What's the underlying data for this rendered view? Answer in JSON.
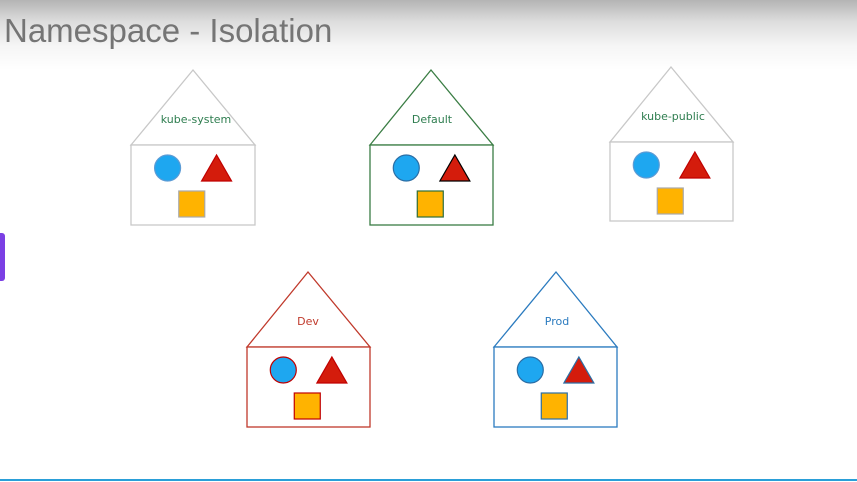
{
  "slide": {
    "title": "Namespace - Isolation"
  },
  "namespaces": [
    {
      "label": "kube-system",
      "outline_color": "#c8c8c8",
      "text_color": "#2e7d4f",
      "circle_stroke": "#5b9bd5",
      "triangle_stroke": "#c00000",
      "square_stroke": "#a9a9a9"
    },
    {
      "label": "Default",
      "outline_color": "#3a7d44",
      "text_color": "#2e7d4f",
      "circle_stroke": "#2b6ea5",
      "triangle_stroke": "#000000",
      "square_stroke": "#2e6e3a"
    },
    {
      "label": "kube-public",
      "outline_color": "#c8c8c8",
      "text_color": "#2e7d4f",
      "circle_stroke": "#5b9bd5",
      "triangle_stroke": "#c00000",
      "square_stroke": "#a9a9a9"
    },
    {
      "label": "Dev",
      "outline_color": "#c0392b",
      "text_color": "#c0392b",
      "circle_stroke": "#c00000",
      "triangle_stroke": "#c00000",
      "square_stroke": "#c00000"
    },
    {
      "label": "Prod",
      "outline_color": "#2b7bbf",
      "text_color": "#2b7bbf",
      "circle_stroke": "#2b6ea5",
      "triangle_stroke": "#2b6ea5",
      "square_stroke": "#2b6ea5"
    }
  ],
  "resource_colors": {
    "circle_fill": "#1ea7f0",
    "triangle_fill": "#d41c0c",
    "square_fill": "#ffb300"
  },
  "accent_colors": {
    "title_text": "#757575",
    "side_tab": "#7b3fe4",
    "bottom_rule": "#2a9fd8"
  }
}
